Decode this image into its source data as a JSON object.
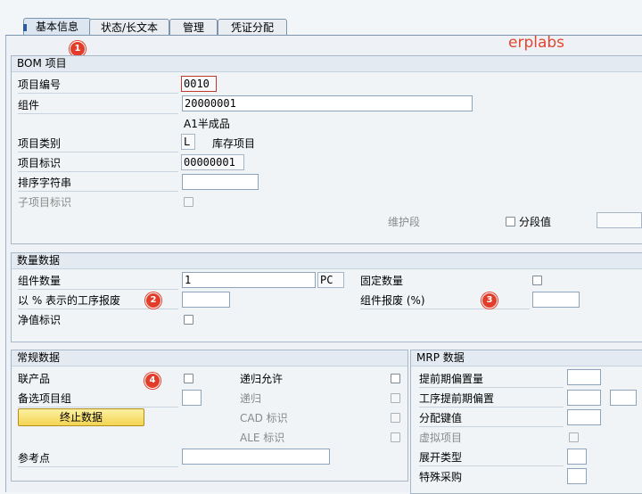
{
  "tabs": [
    "基本信息",
    "状态/长文本",
    "管理",
    "凭证分配"
  ],
  "brand": "erplabs",
  "badges": [
    "1",
    "2",
    "3",
    "4"
  ],
  "bom": {
    "title": "BOM 项目",
    "item_no_label": "项目编号",
    "item_no": "0010",
    "component_label": "组件",
    "component": "20000001",
    "component_desc": "A1半成品",
    "item_category_label": "项目类别",
    "item_category": "L",
    "item_category_desc": "库存项目",
    "item_id_label": "项目标识",
    "item_id": "00000001",
    "sort_string_label": "排序字符串",
    "sort_string": "",
    "sub_item_label": "子项目标识",
    "maint_section_label": "维护段",
    "segment_value_label": "分段值"
  },
  "quantity": {
    "title": "数量数据",
    "component_qty_label": "组件数量",
    "component_qty": "1",
    "uom": "PC",
    "fixed_qty_label": "固定数量",
    "op_scrap_label": "以 % 表示的工序报废",
    "comp_scrap_label": "组件报废 (%)",
    "net_id_label": "净值标识"
  },
  "general": {
    "title": "常规数据",
    "coproduct_label": "联产品",
    "recursive_allowed_label": "递归允许",
    "alt_group_label": "备选项目组",
    "recursive_label": "递归",
    "discontinuation_button": "终止数据",
    "cad_label": "CAD 标识",
    "ale_label": "ALE 标识",
    "ref_point_label": "参考点"
  },
  "mrp": {
    "title": "MRP 数据",
    "lead_offset_label": "提前期偏置量",
    "op_lead_offset_label": "工序提前期偏置",
    "dist_key_label": "分配键值",
    "phantom_label": "虚拟项目",
    "explosion_type_label": "展开类型",
    "special_proc_label": "特殊采购"
  }
}
